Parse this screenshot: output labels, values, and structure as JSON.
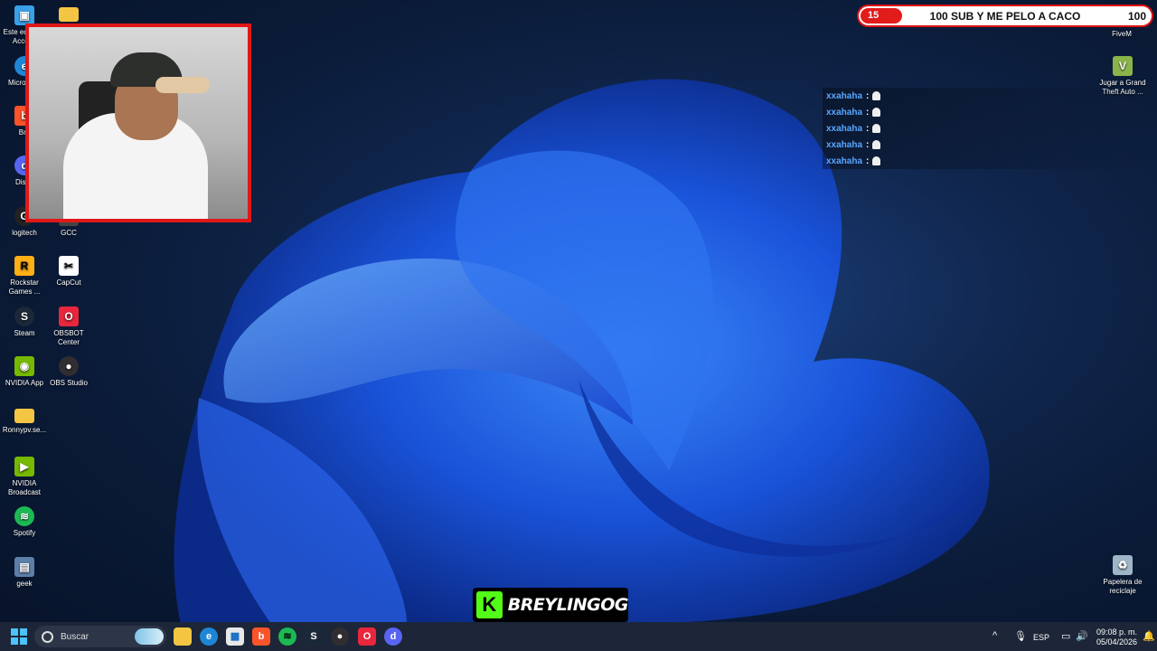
{
  "desktop": {
    "icons": [
      {
        "label": "Este equipo / Acceso",
        "icon": "computer-icon",
        "color": "#3aa0e8"
      },
      {
        "label": "",
        "icon": "folder-icon",
        "color": "#f3c543"
      },
      {
        "label": "Micro Edg",
        "icon": "edge-icon",
        "color": "#1f86d6"
      },
      {
        "label": "Bra",
        "icon": "brave-icon",
        "color": "#fb542b"
      },
      {
        "label": "Disco",
        "icon": "discord-icon",
        "color": "#5865f2"
      },
      {
        "label": "logitech",
        "icon": "logitech-icon",
        "color": "#222222"
      },
      {
        "label": "GCC",
        "icon": "gcc-icon",
        "color": "#444444"
      },
      {
        "label": "Rockstar Games ...",
        "icon": "rockstar-icon",
        "color": "#fcaf17"
      },
      {
        "label": "CapCut",
        "icon": "capcut-icon",
        "color": "#ffffff"
      },
      {
        "label": "Steam",
        "icon": "steam-icon",
        "color": "#1b2838"
      },
      {
        "label": "OBSBOT Center",
        "icon": "obsbot-icon",
        "color": "#e8263c"
      },
      {
        "label": "NVIDIA App",
        "icon": "nvidia-icon",
        "color": "#76b900"
      },
      {
        "label": "OBS Studio",
        "icon": "obs-icon",
        "color": "#302e31"
      },
      {
        "label": "Ronnypv.se...",
        "icon": "folder-icon",
        "color": "#f3c543"
      },
      {
        "label": "NVIDIA Broadcast",
        "icon": "nvidia-broadcast-icon",
        "color": "#76b900"
      },
      {
        "label": "Spotify",
        "icon": "spotify-icon",
        "color": "#1db954"
      },
      {
        "label": "geek",
        "icon": "geek-icon",
        "color": "#5d7fa8"
      },
      {
        "label": "FiveM",
        "icon": "fivem-icon",
        "color": "#f26b1d"
      },
      {
        "label": "Jugar a Grand Theft Auto ...",
        "icon": "gta-icon",
        "color": "#8ab44a"
      },
      {
        "label": "Papelera de reciclaje",
        "icon": "recycle-bin-icon",
        "color": "#9fb6c8"
      }
    ]
  },
  "subgoal": {
    "current": "15",
    "text": "100 SUB Y ME PELO A CACO",
    "goal": "100",
    "progress": 0.15
  },
  "chat": [
    {
      "user": "xxahaha",
      "sep": ":"
    },
    {
      "user": "xxahaha",
      "sep": ":"
    },
    {
      "user": "xxahaha",
      "sep": ":"
    },
    {
      "user": "xxahaha",
      "sep": ":"
    },
    {
      "user": "xxahaha",
      "sep": ":"
    }
  ],
  "streamer": {
    "badge": "K",
    "name": "BREYLINGOG"
  },
  "taskbar": {
    "search_placeholder": "Buscar",
    "apps": [
      "file-explorer-icon",
      "edge-icon",
      "store-icon",
      "brave-icon",
      "spotify-icon",
      "steam-icon",
      "obs-icon",
      "obsbot-icon",
      "discord-icon"
    ],
    "tray": {
      "lang": "ESP",
      "time": "09:08 p. m.",
      "date": "05/04/2026"
    }
  }
}
